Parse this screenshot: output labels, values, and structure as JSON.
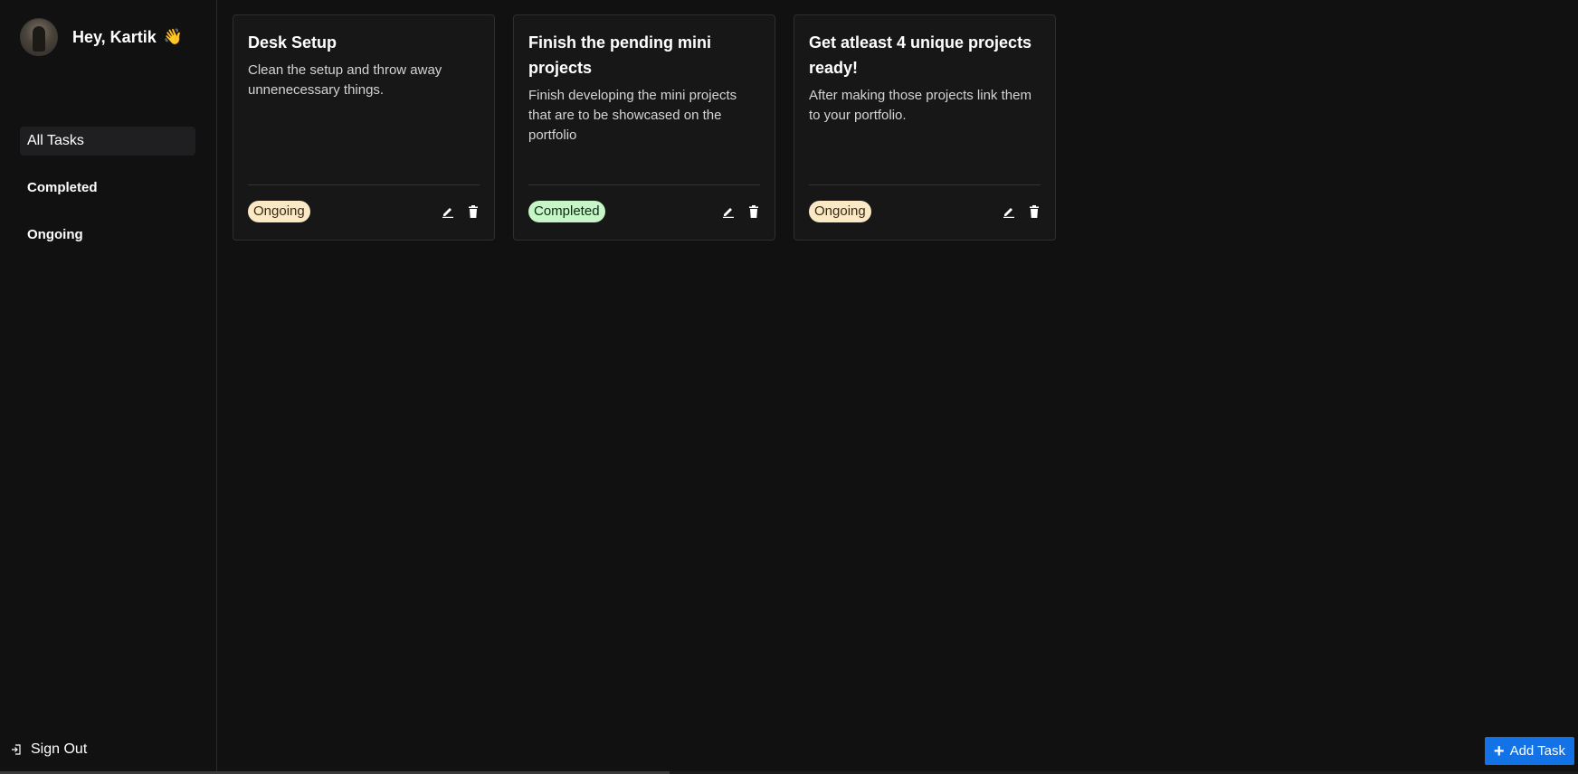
{
  "sidebar": {
    "greeting": "Hey, Kartik",
    "wave_emoji": "👋",
    "nav": [
      {
        "label": "All Tasks",
        "active": true
      },
      {
        "label": "Completed",
        "active": false
      },
      {
        "label": "Ongoing",
        "active": false
      }
    ],
    "sign_out_label": "Sign Out"
  },
  "tasks": [
    {
      "title": "Desk Setup",
      "description": "Clean the setup and throw away unnenecessary things.",
      "status": "Ongoing",
      "status_color": "#fbe9c6"
    },
    {
      "title": "Finish the pending mini projects",
      "description": "Finish developing the mini projects that are to be showcased on the portfolio",
      "status": "Completed",
      "status_color": "#c6f6c8"
    },
    {
      "title": "Get atleast 4 unique projects ready!",
      "description": "After making those projects link them to your portfolio.",
      "status": "Ongoing",
      "status_color": "#fbe9c6"
    }
  ],
  "add_task_label": "Add Task",
  "colors": {
    "background": "#111111",
    "accent": "#1373e6"
  },
  "icons": {
    "edit": "pencil-icon",
    "delete": "trash-icon",
    "sign_out": "sign-out-icon",
    "add": "plus-icon"
  }
}
